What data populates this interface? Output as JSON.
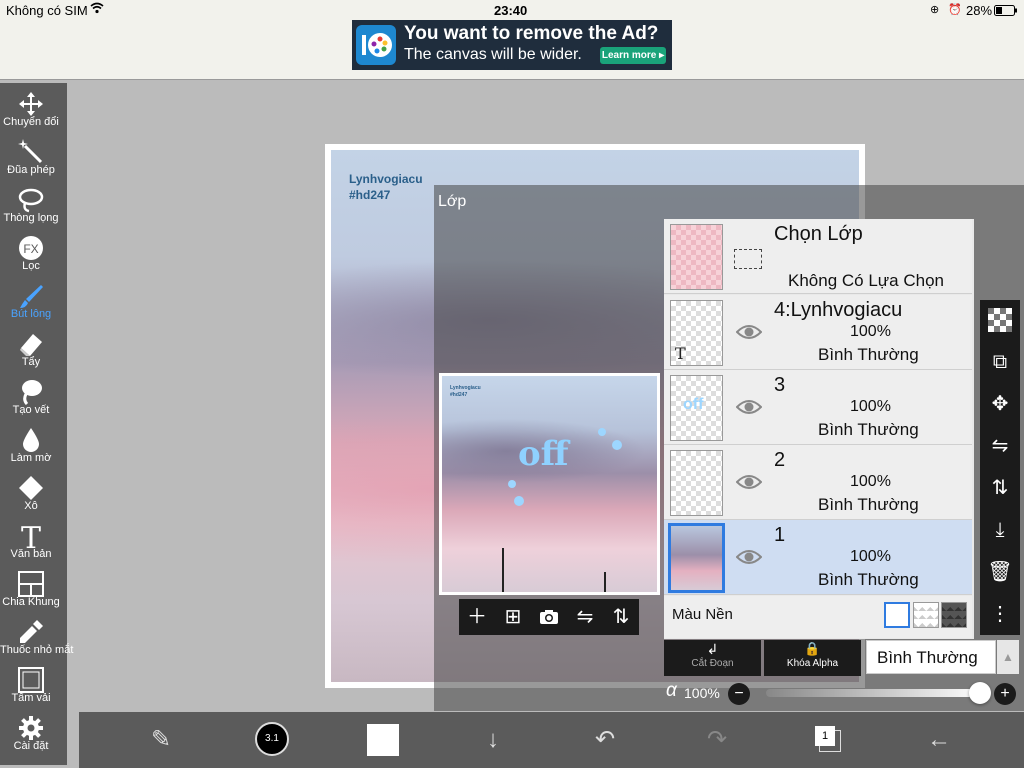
{
  "status": {
    "carrier": "Không có SIM",
    "time": "23:40",
    "battery": "28%"
  },
  "ad": {
    "title": "You want to remove the Ad?",
    "subtitle": "The canvas will be wider.",
    "cta": "Learn more ▸"
  },
  "toolbar": [
    {
      "id": "transform",
      "label": "Chuyển đổi",
      "icon": "move-icon"
    },
    {
      "id": "magic",
      "label": "Đũa phép",
      "icon": "magic-wand-icon"
    },
    {
      "id": "lasso",
      "label": "Thòng lọng",
      "icon": "lasso-icon"
    },
    {
      "id": "filter",
      "label": "Lọc",
      "icon": "fx-icon"
    },
    {
      "id": "brush",
      "label": "Bút lông",
      "icon": "brush-icon",
      "active": true
    },
    {
      "id": "eraser",
      "label": "Tẩy",
      "icon": "eraser-icon"
    },
    {
      "id": "smudge",
      "label": "Tạo vết",
      "icon": "smudge-icon"
    },
    {
      "id": "blur",
      "label": "Làm mờ",
      "icon": "blur-icon"
    },
    {
      "id": "fill",
      "label": "Xô",
      "icon": "bucket-icon"
    },
    {
      "id": "text",
      "label": "Văn bản",
      "icon": "text-icon"
    },
    {
      "id": "frame",
      "label": "Chia Khung",
      "icon": "frame-divider-icon"
    },
    {
      "id": "eyedrop",
      "label": "Thuốc nhỏ mắt",
      "icon": "eyedropper-icon"
    },
    {
      "id": "canvas",
      "label": "Tấm vải",
      "icon": "canvas-icon"
    },
    {
      "id": "settings",
      "label": "Cài đặt",
      "icon": "gear-icon"
    }
  ],
  "canvas": {
    "watermark_line1": "Lynhvogiacu",
    "watermark_line2": "#hd247"
  },
  "layers": {
    "title": "Lớp",
    "selection": {
      "title": "Chọn Lớp",
      "subtitle": "Không Có Lựa Chọn"
    },
    "items": [
      {
        "name": "4:Lynhvogiacu",
        "opacity": "100%",
        "mode": "Bình Thường",
        "type": "text",
        "selected": false
      },
      {
        "name": "3",
        "opacity": "100%",
        "mode": "Bình Thường",
        "type": "sticker",
        "selected": false
      },
      {
        "name": "2",
        "opacity": "100%",
        "mode": "Bình Thường",
        "type": "blank",
        "selected": false
      },
      {
        "name": "1",
        "opacity": "100%",
        "mode": "Bình Thường",
        "type": "photo",
        "selected": true
      }
    ],
    "background_label": "Màu Nền",
    "clipping_label": "Cắt Đoạn",
    "alpha_lock_label": "Khóa Alpha",
    "blend_mode": "Bình Thường",
    "alpha_symbol": "α",
    "alpha_value": "100%",
    "alpha_fraction": 1.0
  },
  "preview": {
    "watermark_line1": "Lynhvogiacu",
    "watermark_line2": "#hd247"
  },
  "bottombar": {
    "brush_size": "3.1",
    "page_count": "1"
  },
  "colors": {
    "accent": "#2f7be0",
    "toolbar": "#5b5b5b",
    "dark": "#1b1b1b"
  }
}
